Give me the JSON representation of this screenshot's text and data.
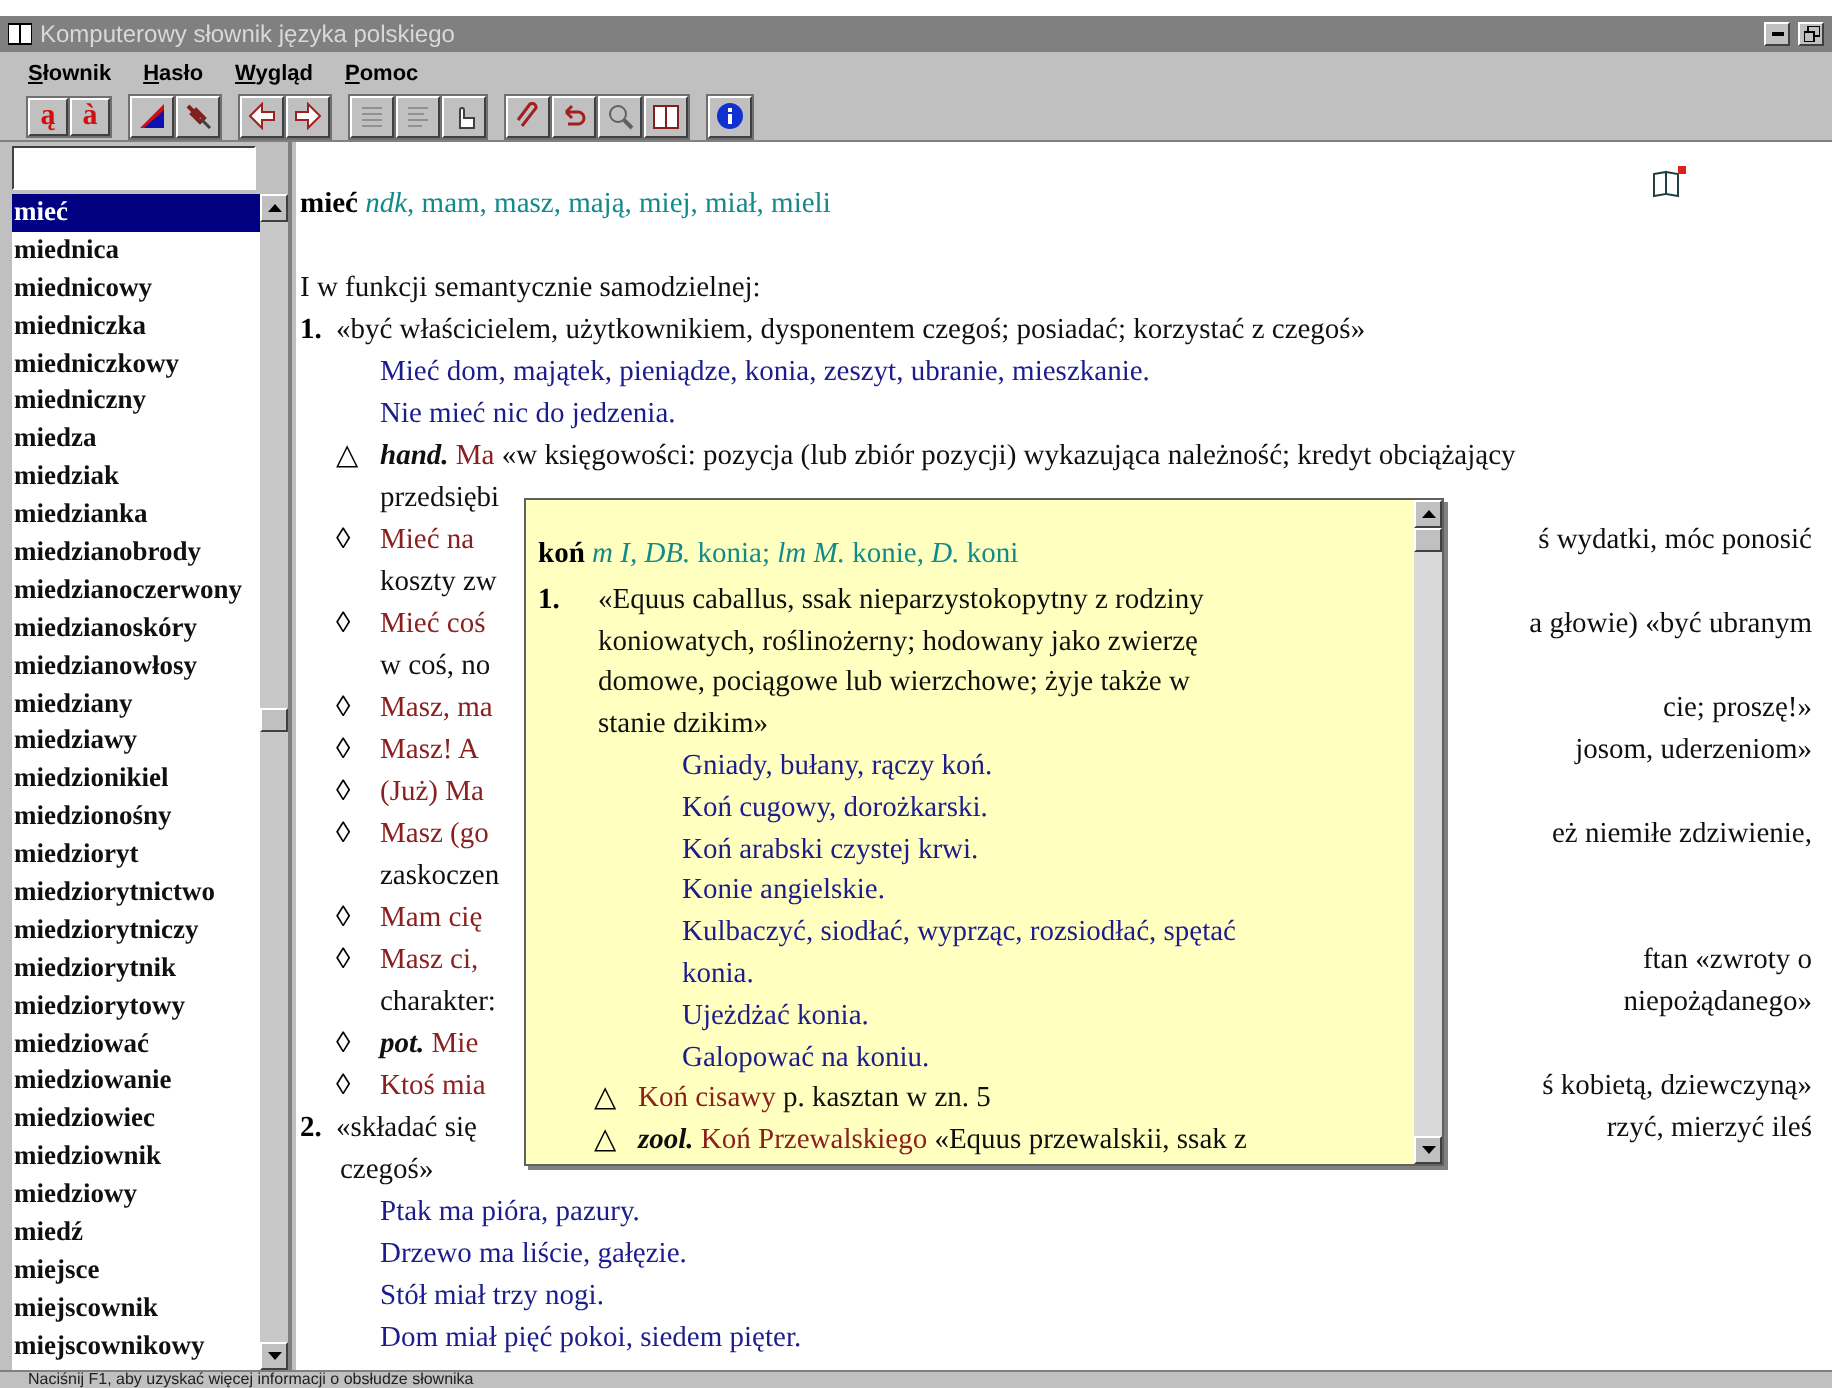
{
  "window": {
    "title": "Komputerowy słownik języka polskiego"
  },
  "menu": [
    "Słownik",
    "Hasło",
    "Wygląd",
    "Pomoc"
  ],
  "toolbar": {
    "letter_buttons": [
      "ą",
      "à"
    ]
  },
  "word_list": [
    {
      "label": "mieć",
      "selected": true
    },
    {
      "label": "miednica",
      "selected": false
    },
    {
      "label": "miednicowy",
      "selected": false
    },
    {
      "label": "miedniczka",
      "selected": false
    },
    {
      "label": "miedniczkowy",
      "selected": false
    },
    {
      "label": "miedniczny",
      "selected": false
    },
    {
      "label": "miedza",
      "selected": false
    },
    {
      "label": "miedziak",
      "selected": false
    },
    {
      "label": "miedzianka",
      "selected": false
    },
    {
      "label": "miedzianobrody",
      "selected": false
    },
    {
      "label": "miedzianoczerwony",
      "selected": false
    },
    {
      "label": "miedzianoskóry",
      "selected": false
    },
    {
      "label": "miedzianowłosy",
      "selected": false
    },
    {
      "label": "miedziany",
      "selected": false
    },
    {
      "label": "miedziawy",
      "selected": false
    },
    {
      "label": "miedzionikiel",
      "selected": false
    },
    {
      "label": "miedzionośny",
      "selected": false
    },
    {
      "label": "miedzioryt",
      "selected": false
    },
    {
      "label": "miedziorytnictwo",
      "selected": false
    },
    {
      "label": "miedziorytniczy",
      "selected": false
    },
    {
      "label": "miedziorytnik",
      "selected": false
    },
    {
      "label": "miedziorytowy",
      "selected": false
    },
    {
      "label": "miedziować",
      "selected": false
    },
    {
      "label": "miedziowanie",
      "selected": false
    },
    {
      "label": "miedziowiec",
      "selected": false
    },
    {
      "label": "miedziownik",
      "selected": false
    },
    {
      "label": "miedziowy",
      "selected": false
    },
    {
      "label": "miedź",
      "selected": false
    },
    {
      "label": "miejsce",
      "selected": false
    },
    {
      "label": "miejscownik",
      "selected": false
    },
    {
      "label": "miejscownikowy",
      "selected": false
    }
  ],
  "entry": {
    "lines": [
      {
        "kind": "headword",
        "segments": [
          {
            "kind": "headword",
            "text": "mieć"
          },
          {
            "kind": "grammar",
            "text": " ndk"
          },
          {
            "kind": "form",
            "text": ", mam, masz, mają, miej, miał, mieli"
          }
        ]
      },
      {
        "kind": "section",
        "segments": [
          {
            "kind": "definition",
            "text": "I w funkcji semantycznie samodzielnej:"
          }
        ]
      },
      {
        "kind": "sense",
        "marker": "1.",
        "segments": [
          {
            "kind": "definition",
            "text": "«być właścicielem, użytkownikiem, dysponentem czegoś; posiadać; korzystać z czegoś»"
          }
        ]
      },
      {
        "kind": "example",
        "segments": [
          {
            "kind": "example",
            "text": "Mieć dom, majątek, pieniądze, konia, zeszyt, ubranie, mieszkanie."
          }
        ]
      },
      {
        "kind": "example",
        "segments": [
          {
            "kind": "example",
            "text": "Nie mieć nic do jedzenia."
          }
        ]
      },
      {
        "kind": "phrase",
        "marker": "△",
        "segments": [
          {
            "kind": "qualifier",
            "text": "hand."
          },
          {
            "kind": "phrase",
            "text": " Ma"
          },
          {
            "kind": "definition",
            "text": " «w księgowości: pozycja (lub zbiór pozycji) wykazująca należność; kredyt obciążający"
          }
        ]
      },
      {
        "kind": "continuation",
        "segments": [
          {
            "kind": "definition",
            "text": "przedsiębi"
          }
        ]
      },
      {
        "kind": "phrase",
        "marker": "◊",
        "segments": [
          {
            "kind": "phrase",
            "text": "Mieć na"
          }
        ],
        "right": "ś wydatki, móc ponosić"
      },
      {
        "kind": "continuation",
        "segments": [
          {
            "kind": "definition",
            "text": "koszty zw"
          }
        ]
      },
      {
        "kind": "phrase",
        "marker": "◊",
        "segments": [
          {
            "kind": "phrase",
            "text": "Mieć coś"
          }
        ],
        "right": "a głowie) «być ubranym"
      },
      {
        "kind": "continuation",
        "segments": [
          {
            "kind": "definition",
            "text": "w coś, no"
          }
        ]
      },
      {
        "kind": "phrase",
        "marker": "◊",
        "segments": [
          {
            "kind": "phrase",
            "text": "Masz, ma"
          }
        ],
        "right": "cie; proszę!»"
      },
      {
        "kind": "phrase",
        "marker": "◊",
        "segments": [
          {
            "kind": "phrase",
            "text": "Masz! A"
          }
        ],
        "right": "josom, uderzeniom»"
      },
      {
        "kind": "phrase",
        "marker": "◊",
        "segments": [
          {
            "kind": "phrase",
            "text": "(Już) Ma"
          }
        ]
      },
      {
        "kind": "phrase",
        "marker": "◊",
        "segments": [
          {
            "kind": "phrase",
            "text": "Masz (go"
          }
        ],
        "right": "eż niemiłe zdziwienie,"
      },
      {
        "kind": "continuation",
        "segments": [
          {
            "kind": "definition",
            "text": "zaskoczen"
          }
        ]
      },
      {
        "kind": "phrase",
        "marker": "◊",
        "segments": [
          {
            "kind": "phrase",
            "text": "Mam cię"
          }
        ]
      },
      {
        "kind": "phrase",
        "marker": "◊",
        "segments": [
          {
            "kind": "phrase",
            "text": "Masz ci,"
          }
        ],
        "right": "ftan «zwroty o"
      },
      {
        "kind": "continuation",
        "segments": [
          {
            "kind": "definition",
            "text": "charakter:"
          }
        ],
        "right": "niepożądanego»"
      },
      {
        "kind": "phrase",
        "marker": "◊",
        "segments": [
          {
            "kind": "qualifier",
            "text": "pot."
          },
          {
            "kind": "phrase",
            "text": " Mie"
          }
        ]
      },
      {
        "kind": "phrase",
        "marker": "◊",
        "segments": [
          {
            "kind": "phrase",
            "text": "Ktoś mia"
          }
        ],
        "right": "ś kobietą, dziewczyną»"
      },
      {
        "kind": "sense",
        "marker": "2.",
        "segments": [
          {
            "kind": "definition",
            "text": "«składać się"
          }
        ],
        "right": "rzyć, mierzyć ileś"
      },
      {
        "kind": "sense_continuation",
        "segments": [
          {
            "kind": "definition",
            "text": "czegoś»"
          }
        ]
      },
      {
        "kind": "example",
        "segments": [
          {
            "kind": "example",
            "text": "Ptak ma pióra, pazury."
          }
        ]
      },
      {
        "kind": "example",
        "segments": [
          {
            "kind": "example",
            "text": "Drzewo ma liście, gałęzie."
          }
        ]
      },
      {
        "kind": "example",
        "segments": [
          {
            "kind": "example",
            "text": "Stół miał trzy nogi."
          }
        ]
      },
      {
        "kind": "example",
        "segments": [
          {
            "kind": "example",
            "text": "Dom miał pięć pokoi, siedem pięter."
          }
        ]
      }
    ]
  },
  "popup": {
    "lines": [
      {
        "kind": "headword",
        "segments": [
          {
            "kind": "headword",
            "text": "koń"
          },
          {
            "kind": "grammar",
            "text": " m I, DB."
          },
          {
            "kind": "form",
            "text": " konia; "
          },
          {
            "kind": "grammar",
            "text": "lm M."
          },
          {
            "kind": "form",
            "text": " konie, "
          },
          {
            "kind": "grammar",
            "text": "D."
          },
          {
            "kind": "form",
            "text": " koni"
          }
        ]
      },
      {
        "kind": "sense",
        "marker": "1.",
        "segments": [
          {
            "kind": "definition",
            "text": "«Equus caballus, ssak nieparzystokopytny z rodziny"
          }
        ]
      },
      {
        "kind": "continuation",
        "segments": [
          {
            "kind": "definition",
            "text": "koniowatych, roślinożerny; hodowany jako zwierzę"
          }
        ]
      },
      {
        "kind": "continuation",
        "segments": [
          {
            "kind": "definition",
            "text": "domowe, pociągowe lub wierzchowe; żyje także w"
          }
        ]
      },
      {
        "kind": "continuation",
        "segments": [
          {
            "kind": "definition",
            "text": "stanie dzikim»"
          }
        ]
      },
      {
        "kind": "example",
        "segments": [
          {
            "kind": "example",
            "text": "Gniady, bułany, rączy koń."
          }
        ]
      },
      {
        "kind": "example",
        "segments": [
          {
            "kind": "example",
            "text": "Koń cugowy, dorożkarski."
          }
        ]
      },
      {
        "kind": "example",
        "segments": [
          {
            "kind": "example",
            "text": "Koń arabski czystej krwi."
          }
        ]
      },
      {
        "kind": "example",
        "segments": [
          {
            "kind": "example",
            "text": "Konie angielskie."
          }
        ]
      },
      {
        "kind": "example",
        "segments": [
          {
            "kind": "example",
            "text": "Kulbaczyć, siodłać, wyprząc, rozsiodłać, spętać"
          }
        ]
      },
      {
        "kind": "example",
        "segments": [
          {
            "kind": "example",
            "text": "konia."
          }
        ]
      },
      {
        "kind": "example",
        "segments": [
          {
            "kind": "example",
            "text": "Ujeżdżać konia."
          }
        ]
      },
      {
        "kind": "example",
        "segments": [
          {
            "kind": "example",
            "text": "Galopować na koniu."
          }
        ]
      },
      {
        "kind": "phrase",
        "marker": "△",
        "segments": [
          {
            "kind": "phrase",
            "text": "Koń cisawy"
          },
          {
            "kind": "definition",
            "text": " p. kasztan w zn. 5"
          }
        ]
      },
      {
        "kind": "phrase",
        "marker": "△",
        "segments": [
          {
            "kind": "qualifier",
            "text": "zool."
          },
          {
            "kind": "phrase",
            "text": " Koń Przewalskiego"
          },
          {
            "kind": "definition",
            "text": " «Equus przewalskii, ssak z"
          }
        ]
      }
    ]
  },
  "status_bar": "Naciśnij F1, aby uzyskać więcej informacji o obsłudze słownika"
}
